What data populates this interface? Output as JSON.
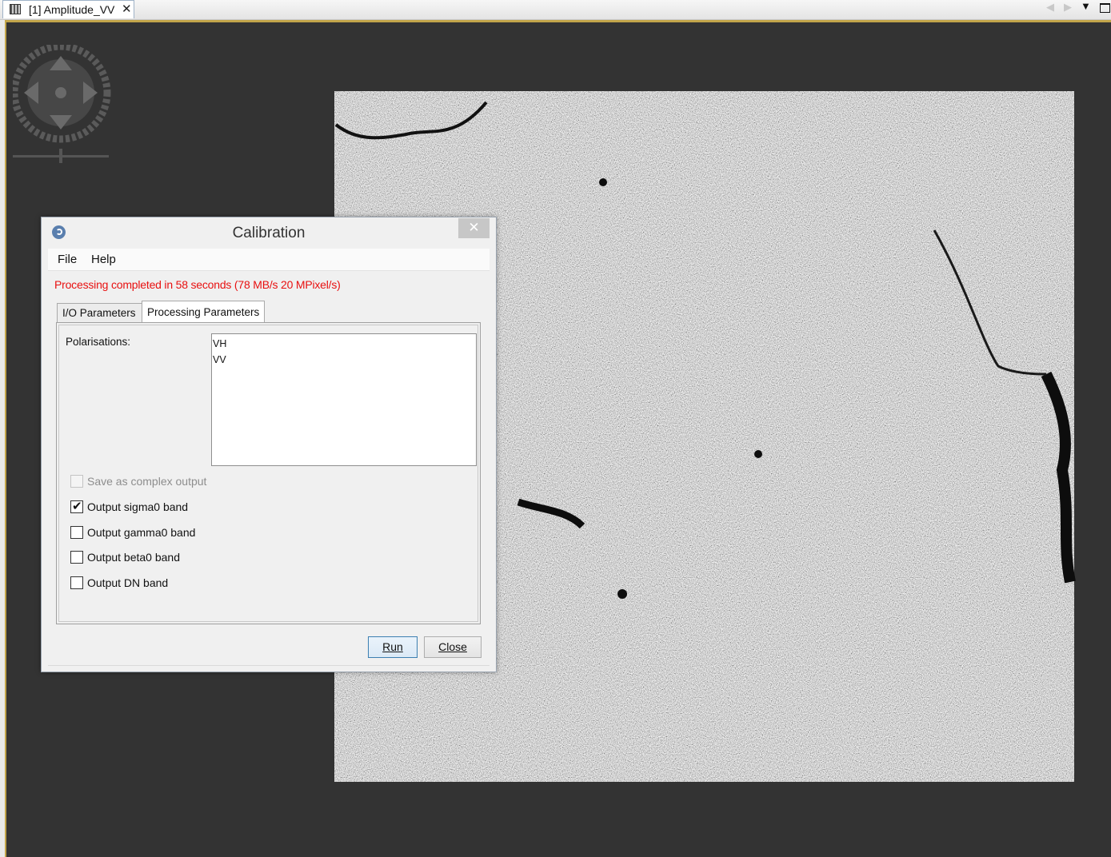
{
  "tab": {
    "label": "[1] Amplitude_VV",
    "close": "✕",
    "icon": "image-band-icon"
  },
  "dialog": {
    "title": "Calibration",
    "close": "✕",
    "menu": [
      "File",
      "Help"
    ],
    "status": "Processing completed in 58 seconds (78 MB/s 20 MPixel/s)",
    "status_color": "#e81010",
    "tabs": [
      "I/O Parameters",
      "Processing Parameters"
    ],
    "active_tab": "Processing Parameters",
    "polarisations_label": "Polarisations:",
    "polarisations": [
      "VH",
      "VV"
    ],
    "options": [
      {
        "label": "Save as complex output",
        "checked": false,
        "enabled": false
      },
      {
        "label": "Output sigma0 band",
        "checked": true,
        "enabled": true
      },
      {
        "label": "Output gamma0 band",
        "checked": false,
        "enabled": true
      },
      {
        "label": "Output beta0 band",
        "checked": false,
        "enabled": true
      },
      {
        "label": "Output DN band",
        "checked": false,
        "enabled": true
      }
    ],
    "buttons": {
      "run": "Run",
      "close": "Close"
    }
  },
  "colors": {
    "viewer_bg": "#333333",
    "frame_accent": "#c2a54a"
  }
}
